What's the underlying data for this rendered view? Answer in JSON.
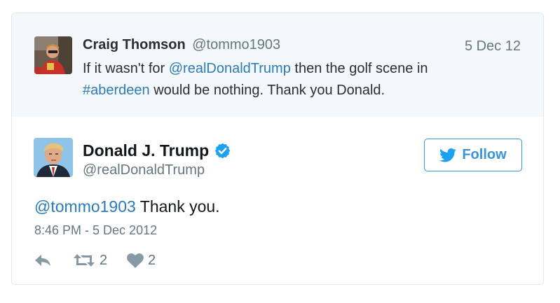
{
  "parent_tweet": {
    "name": "Craig Thomson",
    "handle": "@tommo1903",
    "date": "5 Dec 12",
    "text": {
      "part1": "If it wasn't for ",
      "mention": "@realDonaldTrump",
      "part2": " then the golf scene in",
      "hashtag": "#aberdeen",
      "part3": " would be nothing. Thank you Donald."
    },
    "avatar_icon": "user-avatar-photo"
  },
  "main_tweet": {
    "name": "Donald J. Trump",
    "verified_icon": "verified-badge-icon",
    "handle": "@realDonaldTrump",
    "follow_label": "Follow",
    "text": {
      "mention": "@tommo1903",
      "rest": " Thank you."
    },
    "timestamp": "8:46 PM - 5 Dec 2012",
    "actions": {
      "reply_icon": "reply-icon",
      "retweet_icon": "retweet-icon",
      "retweet_count": "2",
      "like_icon": "heart-icon",
      "like_count": "2"
    }
  },
  "colors": {
    "link": "#2b7bb9",
    "follow": "#3b94d9",
    "verified": "#1da1f2",
    "muted": "#66757f",
    "parent_bg": "#f5f8fa",
    "border": "#e1e8ed"
  }
}
